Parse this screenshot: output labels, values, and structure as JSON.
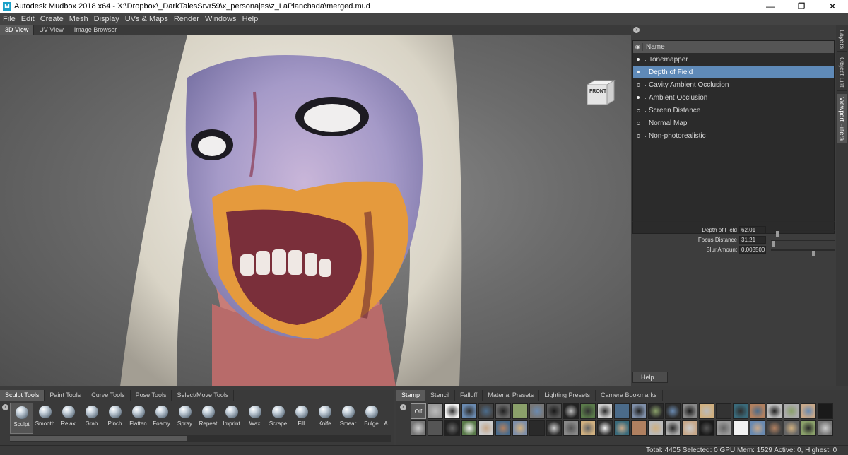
{
  "window": {
    "title": "Autodesk Mudbox 2018 x64 - X:\\Dropbox\\_DarkTalesSrvr59\\x_personajes\\z_LaPlanchada\\merged.mud",
    "minimize": "—",
    "maximize": "❐",
    "close": "✕"
  },
  "menu": [
    "File",
    "Edit",
    "Create",
    "Mesh",
    "Display",
    "UVs & Maps",
    "Render",
    "Windows",
    "Help"
  ],
  "view_tabs": [
    "3D View",
    "UV View",
    "Image Browser"
  ],
  "viewcube_label": "FRONT",
  "filters": {
    "header": "Name",
    "items": [
      {
        "label": "Tonemapper",
        "enabled": true
      },
      {
        "label": "Depth of Field",
        "enabled": true,
        "selected": true
      },
      {
        "label": "Cavity Ambient Occlusion",
        "enabled": false
      },
      {
        "label": "Ambient Occlusion",
        "enabled": true
      },
      {
        "label": "Screen Distance",
        "enabled": false
      },
      {
        "label": "Normal Map",
        "enabled": false
      },
      {
        "label": "Non-photorealistic",
        "enabled": false
      }
    ]
  },
  "properties": [
    {
      "label": "Depth of Field",
      "value": "62.01",
      "slider": 0.08
    },
    {
      "label": "Focus Distance",
      "value": "31.21",
      "slider": 0.02
    },
    {
      "label": "Blur Amount",
      "value": "0.003500",
      "slider": 0.68
    }
  ],
  "help_label": "Help...",
  "side_tabs": [
    "Layers",
    "Object List",
    "Viewport Filters"
  ],
  "sculpt_tabs": [
    "Sculpt Tools",
    "Paint Tools",
    "Curve Tools",
    "Pose Tools",
    "Select/Move Tools"
  ],
  "sculpt_tools": [
    "Sculpt",
    "Smooth",
    "Relax",
    "Grab",
    "Pinch",
    "Flatten",
    "Foamy",
    "Spray",
    "Repeat",
    "Imprint",
    "Wax",
    "Scrape",
    "Fill",
    "Knife",
    "Smear",
    "Bulge",
    "A"
  ],
  "stamp_tabs": [
    "Stamp",
    "Stencil",
    "Falloff",
    "Material Presets",
    "Lighting Presets",
    "Camera Bookmarks"
  ],
  "stamp_off_label": "Off",
  "status": "Total: 4405  Selected: 0 GPU Mem: 1529  Active: 0, Highest: 0"
}
